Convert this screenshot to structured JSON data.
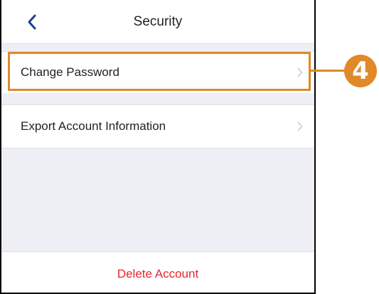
{
  "header": {
    "title": "Security",
    "back_icon": "chevron-left-icon"
  },
  "menu": {
    "items": [
      {
        "label": "Change Password",
        "icon": "chevron-right-icon",
        "highlighted": true
      },
      {
        "label": "Export Account Information",
        "icon": "chevron-right-icon",
        "highlighted": false
      }
    ],
    "delete_label": "Delete Account"
  },
  "annotation": {
    "step_number": "4",
    "color": "#e0892a"
  },
  "colors": {
    "accent_blue": "#1f3f8f",
    "danger_red": "#e8262d",
    "background": "#eeeff4"
  }
}
